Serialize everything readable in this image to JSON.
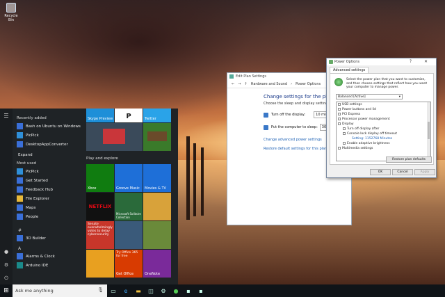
{
  "desktop": {
    "recycle_bin_label": "Recycle Bin"
  },
  "taskbar": {
    "search_placeholder": "Ask me anything",
    "pinned": [
      "task-view",
      "edge",
      "file-explorer",
      "store",
      "settings",
      "xbox",
      "app",
      "app"
    ]
  },
  "start": {
    "recently_added_heading": "Recently added",
    "recently_added": [
      "Bash on Ubuntu on Windows",
      "PicPick",
      "DesktopAppConverter"
    ],
    "expand_label": "Expand",
    "most_used_heading": "Most used",
    "most_used": [
      "PicPick",
      "Get Started",
      "Feedback Hub",
      "File Explorer",
      "Maps",
      "People"
    ],
    "letter_hash": "#",
    "hash_apps": [
      "3D Builder"
    ],
    "letter_a": "A",
    "a_apps": [
      "Alarms & Clock",
      "Arduino IDE"
    ],
    "play_group": "Play and explore",
    "tiles": {
      "skype": "Skype Preview",
      "twitter": "Twitter",
      "xbox": "Xbox",
      "groove": "Groove Music",
      "movies": "Movies & TV",
      "netflix": "NETFLIX",
      "solitaire": "Microsoft Solitaire Collection",
      "news_line1": "Senate",
      "news_line2": "overwhelmingly",
      "news_line3": "votes to delay",
      "news_line4": "cybersecurity",
      "office_line1": "Try Office 365",
      "office_line2": "for free",
      "getoffice": "Get Office",
      "onenote": "OneNote"
    }
  },
  "edit_plan": {
    "title": "Edit Plan Settings",
    "breadcrumb": [
      "Hardware and Sound",
      "Power Options"
    ],
    "heading": "Change settings for the plan: Bala",
    "subheading": "Choose the sleep and display settings that y",
    "display_label": "Turn off the display:",
    "display_value": "10 minut",
    "sleep_label": "Put the computer to sleep:",
    "sleep_value": "30 minut",
    "advanced_link": "Change advanced power settings",
    "restore_link": "Restore default settings for this plan"
  },
  "power_options": {
    "title": "Power Options",
    "title_buttons": "? ✕",
    "tab": "Advanced settings",
    "intro": "Select the power plan that you want to customize, and then choose settings that reflect how you want your computer to manage power.",
    "plan": "Balanced [Active]",
    "tree": [
      "USB settings",
      "Power buttons and lid",
      "PCI Express",
      "Processor power management",
      "Display",
      "Turn off display after",
      "Console lock display off timeout",
      "Setting: 1152768 Minutes",
      "Enable adaptive brightness",
      "Multimedia settings"
    ],
    "restore_button": "Restore plan defaults",
    "ok": "OK",
    "cancel": "Cancel",
    "apply": "Apply"
  }
}
